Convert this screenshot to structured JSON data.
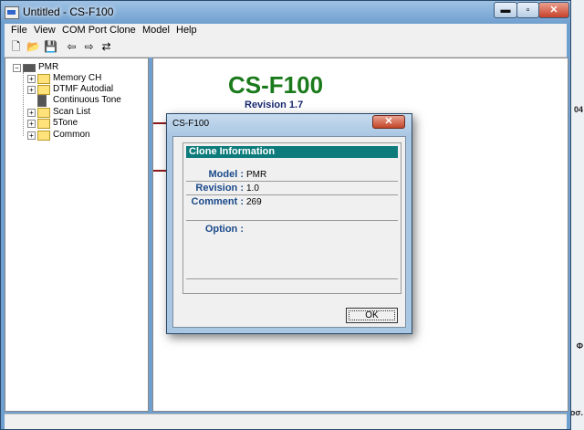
{
  "window": {
    "title": "Untitled - CS-F100",
    "min_glyph": "▬",
    "max_glyph": "▫",
    "close_glyph": "✕"
  },
  "menu": [
    "File",
    "View",
    "COM Port",
    "Clone",
    "Model",
    "Help"
  ],
  "toolbar": [
    "new-icon",
    "open-icon",
    "save-icon",
    "read-radio-icon",
    "write-radio-icon",
    "clone-radio-icon"
  ],
  "tree": {
    "root": "PMR",
    "items": [
      "Memory CH",
      "DTMF Autodial",
      "Continuous Tone",
      "Scan List",
      "5Tone",
      "Common"
    ]
  },
  "main": {
    "brand": "CS-F100",
    "revision": "Revision 1.7"
  },
  "right_edge": {
    "t1": "04",
    "t2": "Φ",
    "t3": "οσ."
  },
  "dialog": {
    "title": "CS-F100",
    "close_glyph": "✕",
    "header": "Clone Information",
    "model_label": "Model :",
    "model_value": "PMR",
    "revision_label": "Revision :",
    "revision_value": "1.0",
    "comment_label": "Comment :",
    "comment_value": "269",
    "option_label": "Option :",
    "ok_label": "OK"
  }
}
